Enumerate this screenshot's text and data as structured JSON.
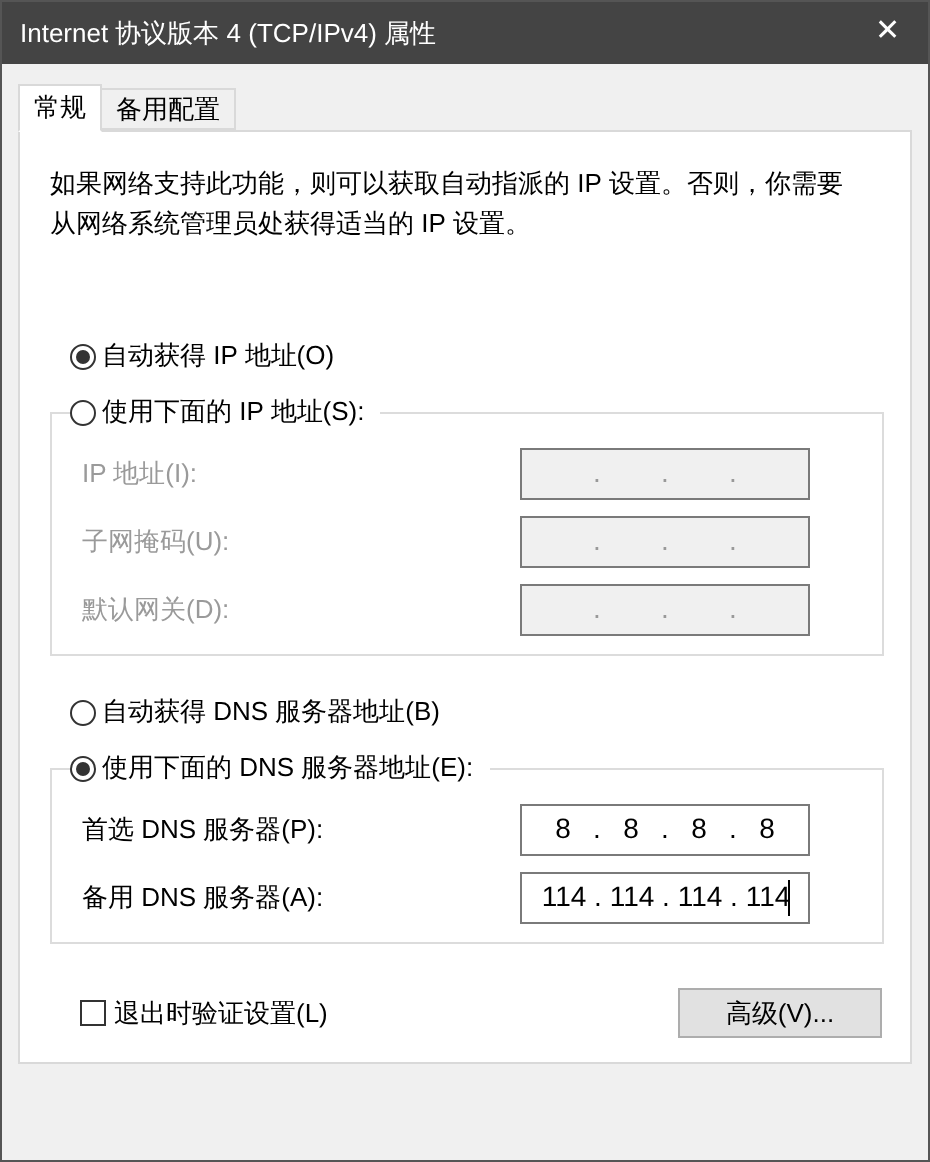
{
  "window": {
    "title": "Internet 协议版本 4 (TCP/IPv4) 属性",
    "close": "✕"
  },
  "tabs": [
    {
      "label": "常规",
      "selected": true
    },
    {
      "label": "备用配置",
      "selected": false
    }
  ],
  "description": "如果网络支持此功能，则可以获取自动指派的 IP 设置。否则，你需要从网络系统管理员处获得适当的 IP 设置。",
  "ip_section": {
    "options": [
      {
        "label": "自动获得 IP 地址(O)",
        "selected": true
      },
      {
        "label": "使用下面的 IP 地址(S):",
        "selected": false
      }
    ],
    "fields": [
      {
        "label": "IP 地址(I):",
        "disabled": true,
        "separators": [
          ".",
          ".",
          "."
        ]
      },
      {
        "label": "子网掩码(U):",
        "disabled": true,
        "separators": [
          ".",
          ".",
          "."
        ]
      },
      {
        "label": "默认网关(D):",
        "disabled": true,
        "separators": [
          ".",
          ".",
          "."
        ]
      }
    ]
  },
  "dns_section": {
    "options": [
      {
        "label": "自动获得 DNS 服务器地址(B)",
        "selected": false
      },
      {
        "label": "使用下面的 DNS 服务器地址(E):",
        "selected": true
      }
    ],
    "fields": [
      {
        "label": "首选 DNS 服务器(P):",
        "disabled": false,
        "octets": [
          "8",
          "8",
          "8",
          "8"
        ],
        "separators": [
          ".",
          ".",
          "."
        ]
      },
      {
        "label": "备用 DNS 服务器(A):",
        "disabled": false,
        "octets": [
          "114",
          "114",
          "114",
          "114"
        ],
        "separators": [
          ".",
          ".",
          "."
        ],
        "focused": true
      }
    ]
  },
  "validate_checkbox": {
    "label": "退出时验证设置(L)",
    "checked": false
  },
  "advanced_button": "高级(V)..."
}
